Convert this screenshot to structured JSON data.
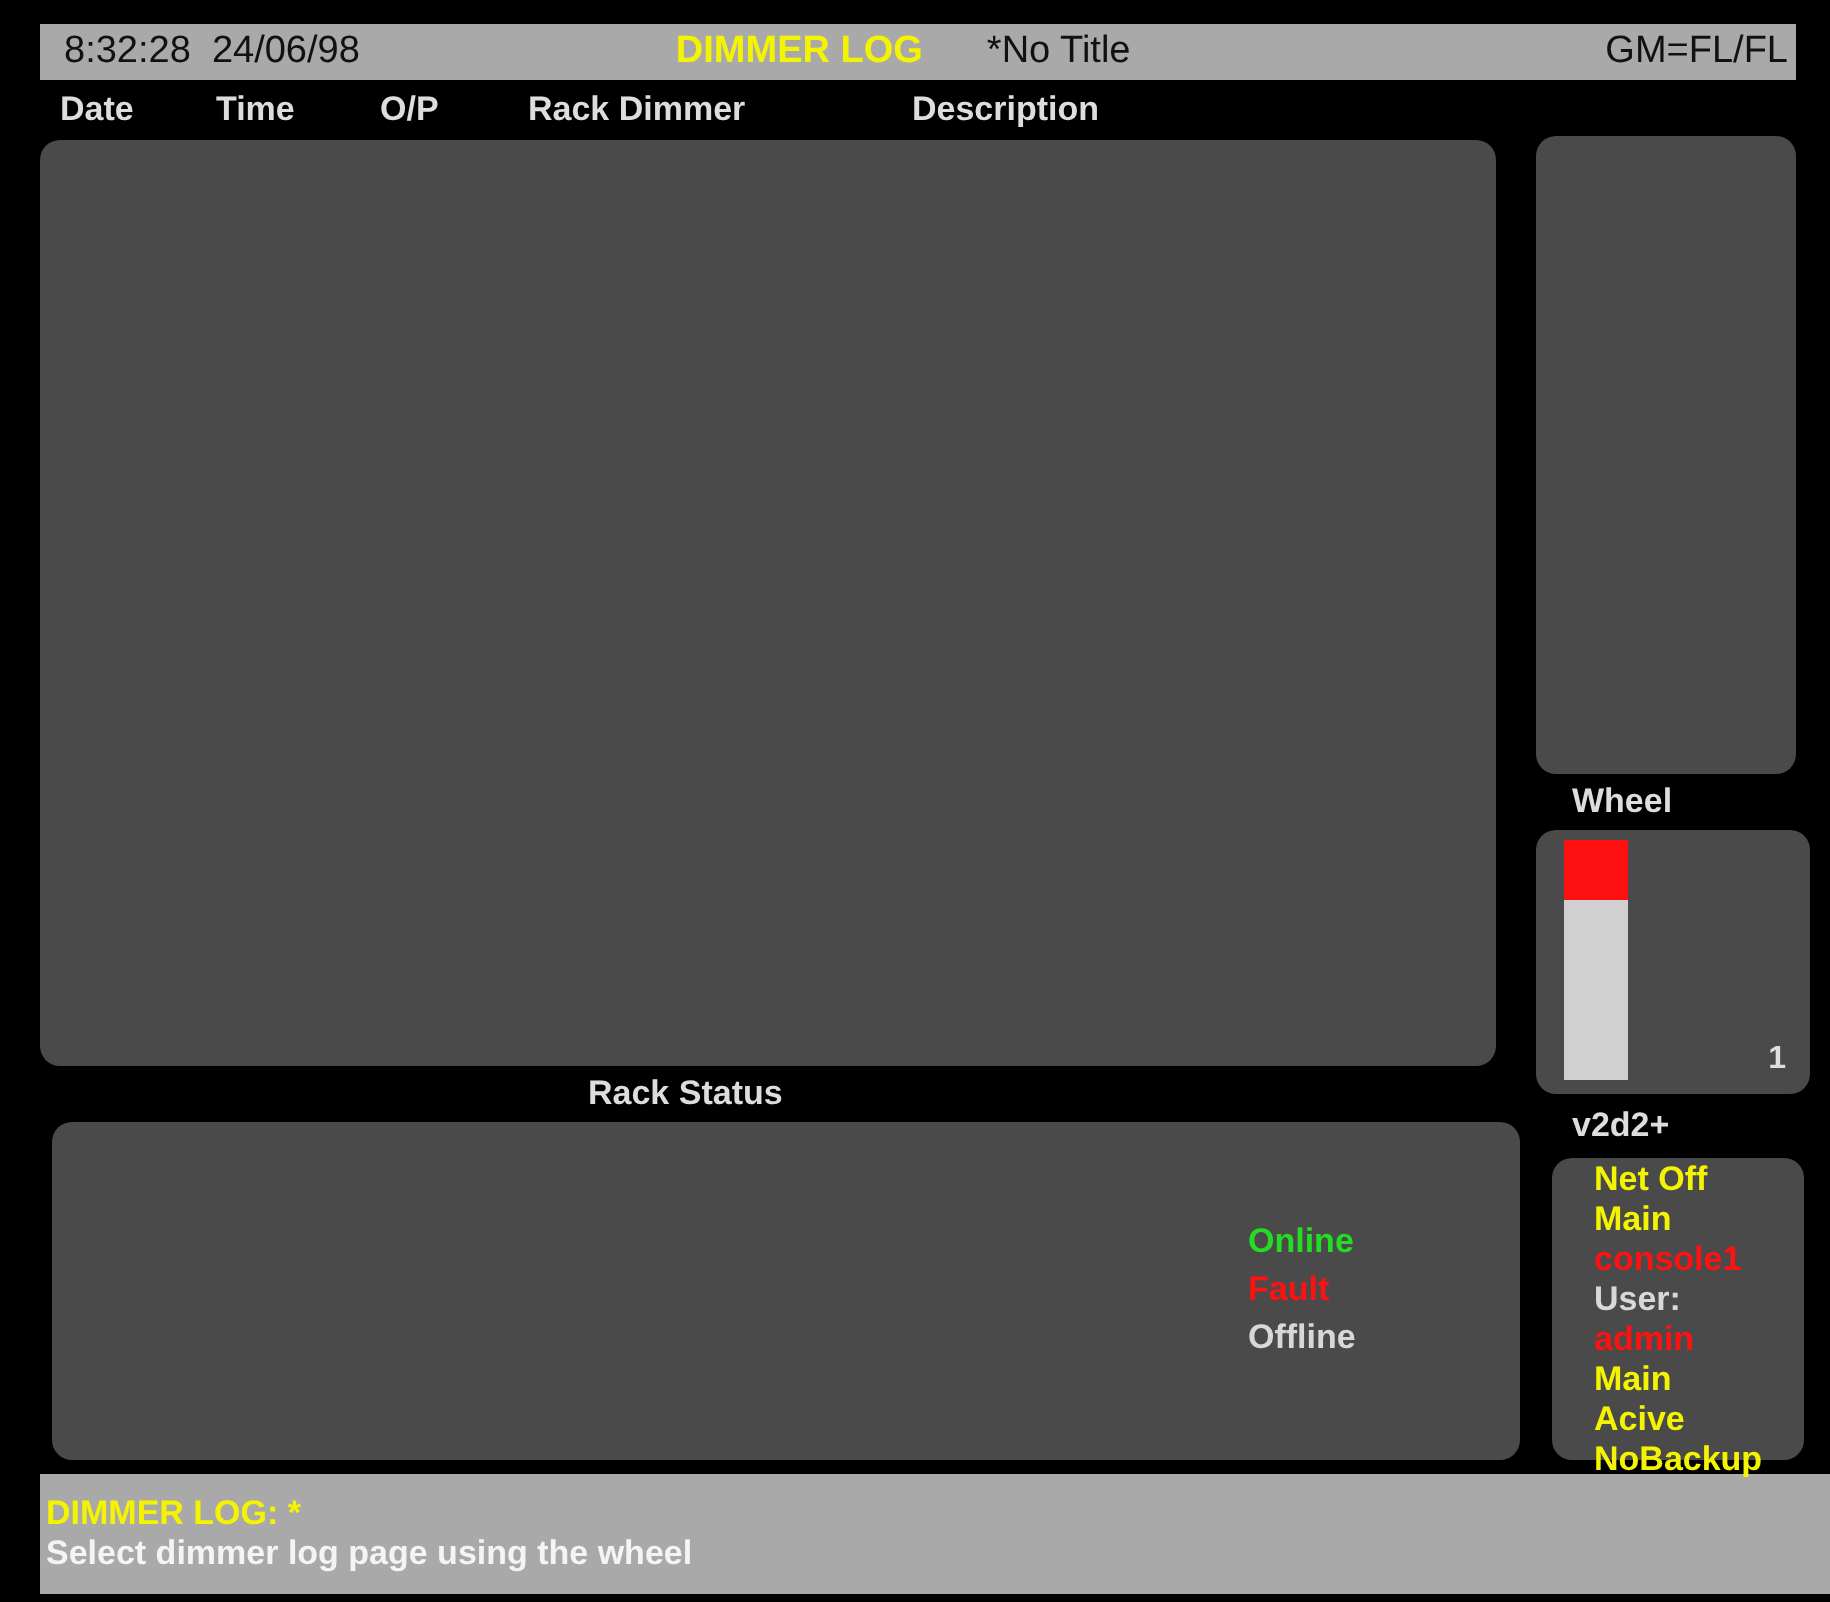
{
  "header": {
    "clock": "8:32:28  24/06/98",
    "title": "DIMMER LOG",
    "show": "*No Title",
    "grand_master": "GM=FL/FL"
  },
  "columns": [
    "Date",
    "Time",
    "O/P",
    "Rack Dimmer",
    "Description"
  ],
  "wheel": {
    "label": "Wheel",
    "level": 0.25,
    "value": "1"
  },
  "rack_status": {
    "label": "Rack Status",
    "legend": [
      {
        "text": "Online",
        "color": "#22dd22"
      },
      {
        "text": "Fault",
        "color": "#ff1111"
      },
      {
        "text": "Offline",
        "color": "#d8d8d8"
      }
    ]
  },
  "system": {
    "label": "v2d2+",
    "lines": [
      {
        "text": "Net Off",
        "color": "#f4f400"
      },
      {
        "text": "Main",
        "color": "#f4f400"
      },
      {
        "text": "console1",
        "color": "#ff1111"
      },
      {
        "text": "User:",
        "color": "#d8d8d8"
      },
      {
        "text": "admin",
        "color": "#ff1111"
      },
      {
        "text": "Main",
        "color": "#f4f400"
      },
      {
        "text": "Acive",
        "color": "#f4f400"
      },
      {
        "text": "NoBackup",
        "color": "#f4f400"
      }
    ]
  },
  "prompt": {
    "heading": "DIMMER LOG: *",
    "message": "Select dimmer log page using the wheel"
  }
}
